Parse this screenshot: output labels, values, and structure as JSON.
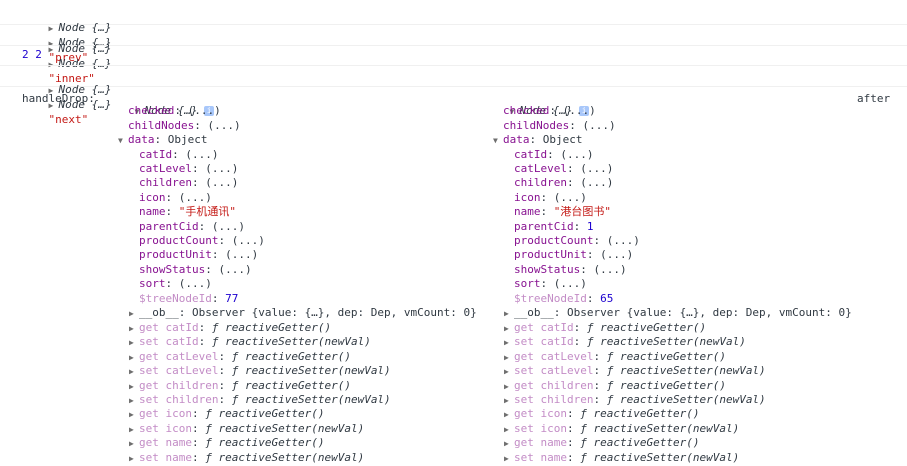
{
  "log_rows": [
    {
      "a": "Node {…}",
      "b": "Node {…}",
      "s": "\"prev\""
    },
    {
      "a": "Node {…}",
      "b": "Node {…}",
      "s": "\"inner\""
    },
    {
      "numbers": "2 2"
    },
    {
      "a": "Node {…}",
      "b": "Node {…}",
      "s": "\"next\""
    }
  ],
  "drop": {
    "label": "handleDrop:",
    "after": "after",
    "left": {
      "root": "Node {…}",
      "checked": "checked",
      "childNodes": "childNodes",
      "data_label": "data",
      "data_type": "Object",
      "collapsed_value": "(...)",
      "data_fields": {
        "catId": "catId",
        "catLevel": "catLevel",
        "children": "children",
        "icon": "icon",
        "name": "name",
        "name_value": "\"手机通讯\"",
        "parentCid": "parentCid",
        "parentCid_value": "(...)",
        "productCount": "productCount",
        "productUnit": "productUnit",
        "showStatus": "showStatus",
        "sort": "sort",
        "treeNodeId": "$treeNodeId",
        "treeNodeId_value": "77"
      },
      "ob": "__ob__: Observer {value: {…}, dep: Dep, vmCount: 0}",
      "accessors": [
        {
          "kind": "get",
          "key": "catId",
          "fn": "reactiveGetter()"
        },
        {
          "kind": "set",
          "key": "catId",
          "fn": "reactiveSetter(newVal)"
        },
        {
          "kind": "get",
          "key": "catLevel",
          "fn": "reactiveGetter()"
        },
        {
          "kind": "set",
          "key": "catLevel",
          "fn": "reactiveSetter(newVal)"
        },
        {
          "kind": "get",
          "key": "children",
          "fn": "reactiveGetter()"
        },
        {
          "kind": "set",
          "key": "children",
          "fn": "reactiveSetter(newVal)"
        },
        {
          "kind": "get",
          "key": "icon",
          "fn": "reactiveGetter()"
        },
        {
          "kind": "set",
          "key": "icon",
          "fn": "reactiveSetter(newVal)"
        },
        {
          "kind": "get",
          "key": "name",
          "fn": "reactiveGetter()"
        },
        {
          "kind": "set",
          "key": "name",
          "fn": "reactiveSetter(newVal)"
        }
      ]
    },
    "right": {
      "root": "Node {…}",
      "checked": "checked",
      "childNodes": "childNodes",
      "data_label": "data",
      "data_type": "Object",
      "collapsed_value": "(...)",
      "data_fields": {
        "catId": "catId",
        "catLevel": "catLevel",
        "children": "children",
        "icon": "icon",
        "name": "name",
        "name_value": "\"港台图书\"",
        "parentCid": "parentCid",
        "parentCid_value": "1",
        "productCount": "productCount",
        "productUnit": "productUnit",
        "showStatus": "showStatus",
        "sort": "sort",
        "treeNodeId": "$treeNodeId",
        "treeNodeId_value": "65"
      },
      "ob": "__ob__: Observer {value: {…}, dep: Dep, vmCount: 0}",
      "accessors": [
        {
          "kind": "get",
          "key": "catId",
          "fn": "reactiveGetter()"
        },
        {
          "kind": "set",
          "key": "catId",
          "fn": "reactiveSetter(newVal)"
        },
        {
          "kind": "get",
          "key": "catLevel",
          "fn": "reactiveGetter()"
        },
        {
          "kind": "set",
          "key": "catLevel",
          "fn": "reactiveSetter(newVal)"
        },
        {
          "kind": "get",
          "key": "children",
          "fn": "reactiveGetter()"
        },
        {
          "kind": "set",
          "key": "children",
          "fn": "reactiveSetter(newVal)"
        },
        {
          "kind": "get",
          "key": "icon",
          "fn": "reactiveGetter()"
        },
        {
          "kind": "set",
          "key": "icon",
          "fn": "reactiveSetter(newVal)"
        },
        {
          "kind": "get",
          "key": "name",
          "fn": "reactiveGetter()"
        },
        {
          "kind": "set",
          "key": "name",
          "fn": "reactiveSetter(newVal)"
        }
      ]
    },
    "func_symbol": "ƒ",
    "colors": {
      "string": "#c41a16",
      "number": "#1c00cf",
      "key": "#881391"
    }
  }
}
